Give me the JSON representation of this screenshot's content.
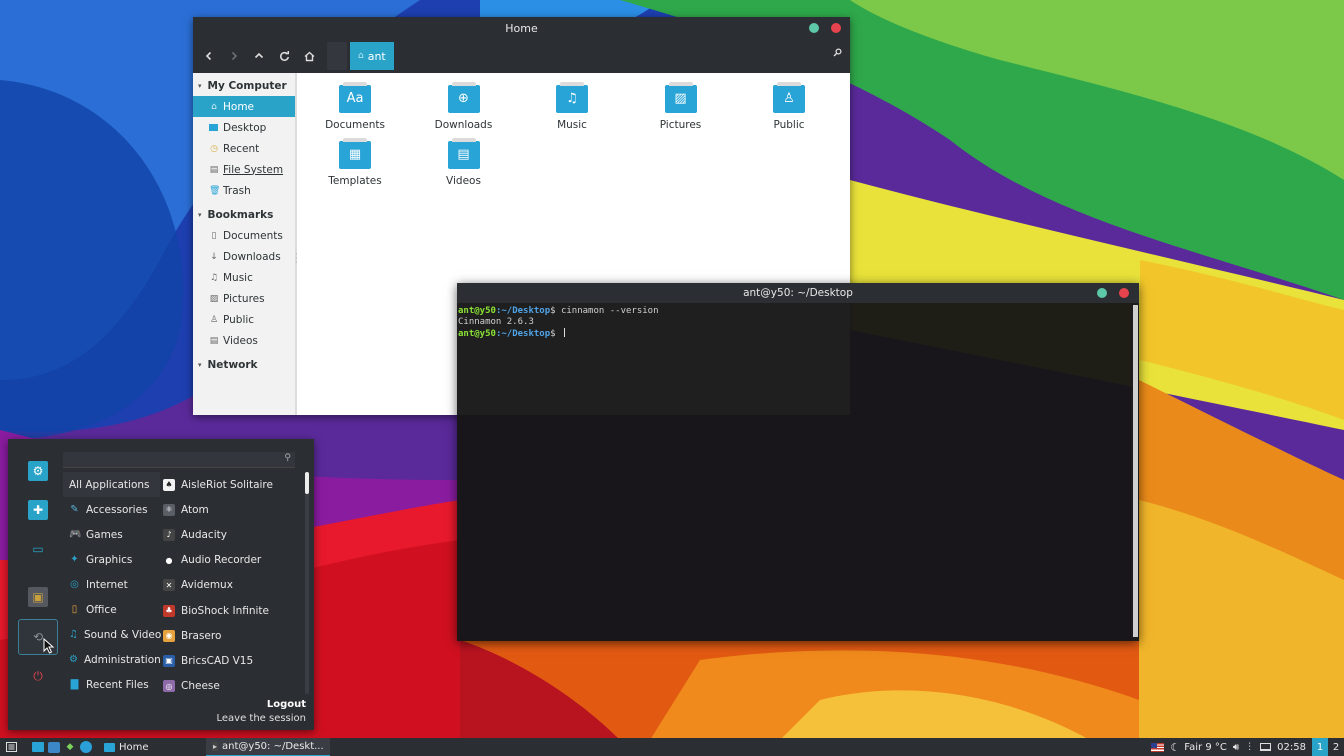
{
  "colors": {
    "accent": "#2aa3c9",
    "close": "#e5444e",
    "maximize": "#5dc8a8",
    "folder": "#29a4d6",
    "prompt_user": "#8ae234",
    "prompt_path": "#4fa3e8"
  },
  "file_manager": {
    "title": "Home",
    "toolbar": {
      "back_icon": "arrow-left-icon",
      "forward_icon": "arrow-right-icon",
      "up_icon": "arrow-up-icon",
      "reload_icon": "reload-icon",
      "home_icon": "home-icon",
      "breadcrumb": "ant",
      "search_icon": "search-icon"
    },
    "sidebar": {
      "sections": [
        {
          "title": "My Computer",
          "items": [
            {
              "label": "Home",
              "icon": "home-icon",
              "selected": true
            },
            {
              "label": "Desktop",
              "icon": "desktop-icon"
            },
            {
              "label": "Recent",
              "icon": "clock-icon"
            },
            {
              "label": "File System",
              "icon": "drive-icon",
              "underline": true
            },
            {
              "label": "Trash",
              "icon": "trash-icon"
            }
          ]
        },
        {
          "title": "Bookmarks",
          "items": [
            {
              "label": "Documents",
              "icon": "document-icon"
            },
            {
              "label": "Downloads",
              "icon": "download-icon"
            },
            {
              "label": "Music",
              "icon": "music-icon"
            },
            {
              "label": "Pictures",
              "icon": "picture-icon"
            },
            {
              "label": "Public",
              "icon": "share-icon"
            },
            {
              "label": "Videos",
              "icon": "film-icon"
            }
          ]
        },
        {
          "title": "Network",
          "items": []
        }
      ]
    },
    "folders": [
      {
        "label": "Documents",
        "icon": "documents-folder-icon",
        "glyph": "Aa"
      },
      {
        "label": "Downloads",
        "icon": "downloads-folder-icon",
        "glyph": "⊕"
      },
      {
        "label": "Music",
        "icon": "music-folder-icon",
        "glyph": "♫"
      },
      {
        "label": "Pictures",
        "icon": "pictures-folder-icon",
        "glyph": "▨"
      },
      {
        "label": "Public",
        "icon": "public-folder-icon",
        "glyph": "♙"
      },
      {
        "label": "Templates",
        "icon": "templates-folder-icon",
        "glyph": "▦"
      },
      {
        "label": "Videos",
        "icon": "videos-folder-icon",
        "glyph": "▤"
      }
    ]
  },
  "terminal": {
    "title": "ant@y50: ~/Desktop",
    "lines": [
      {
        "user": "ant@y50",
        "path": ":~/Desktop",
        "symbol": "$",
        "command": " cinnamon --version"
      },
      {
        "output": "Cinnamon 2.6.3"
      },
      {
        "user": "ant@y50",
        "path": ":~/Desktop",
        "symbol": "$",
        "command": " "
      }
    ]
  },
  "menu": {
    "search_placeholder": "",
    "favorites": [
      {
        "name": "settings-icon",
        "color": "#2aa3c9"
      },
      {
        "name": "software-icon",
        "color": "#2aa3c9"
      },
      {
        "name": "toggle-icon",
        "color": "#2aa3c9"
      },
      {
        "name": "screen-lock-icon",
        "color": "#c8a03c"
      },
      {
        "name": "logout-icon",
        "color": "#8a8f95"
      },
      {
        "name": "power-icon",
        "color": "#e5444e"
      }
    ],
    "categories": [
      {
        "label": "All Applications",
        "icon": "",
        "selected": true
      },
      {
        "label": "Accessories",
        "icon": "✎"
      },
      {
        "label": "Games",
        "icon": "🎮"
      },
      {
        "label": "Graphics",
        "icon": "✦"
      },
      {
        "label": "Internet",
        "icon": "◎"
      },
      {
        "label": "Office",
        "icon": "▯"
      },
      {
        "label": "Sound & Video",
        "icon": "♫"
      },
      {
        "label": "Administration",
        "icon": "⚙"
      },
      {
        "label": "Recent Files",
        "icon": "▇"
      }
    ],
    "applications": [
      {
        "label": "AisleRiot Solitaire",
        "icon": "cards-icon",
        "color": "#f2f2f2",
        "glyph": "♠"
      },
      {
        "label": "Atom",
        "icon": "atom-icon",
        "color": "#5a5f66",
        "glyph": "⚛"
      },
      {
        "label": "Audacity",
        "icon": "headphones-icon",
        "color": "#444",
        "glyph": "♪"
      },
      {
        "label": "Audio Recorder",
        "icon": "microphone-icon",
        "color": "#2b2e33",
        "glyph": "●"
      },
      {
        "label": "Avidemux",
        "icon": "avidemux-icon",
        "color": "#444",
        "glyph": "✕"
      },
      {
        "label": "BioShock Infinite",
        "icon": "bioshock-icon",
        "color": "#c0392b",
        "glyph": "♣"
      },
      {
        "label": "Brasero",
        "icon": "brasero-icon",
        "color": "#e6a23c",
        "glyph": "◉"
      },
      {
        "label": "BricsCAD V15",
        "icon": "bricscad-icon",
        "color": "#2a5fa8",
        "glyph": "▣"
      },
      {
        "label": "Cheese",
        "icon": "cheese-icon",
        "color": "#8e6aa8",
        "glyph": "◎"
      }
    ],
    "info_title": "Logout",
    "info_desc": "Leave the session"
  },
  "panel": {
    "menu_icon": "menu-icon",
    "launchers": [
      "files-icon",
      "browser-icon",
      "terminal-icon",
      "telegram-icon"
    ],
    "windows": [
      {
        "label": "Home",
        "icon": "folder-icon",
        "active": false
      },
      {
        "label": "ant@y50: ~/Deskt...",
        "icon": "terminal-icon",
        "active": true
      }
    ],
    "keyboard_flag": "us-flag-icon",
    "weather": "Fair 9 °C",
    "clock": "02:58",
    "workspaces": [
      "1",
      "2"
    ]
  }
}
